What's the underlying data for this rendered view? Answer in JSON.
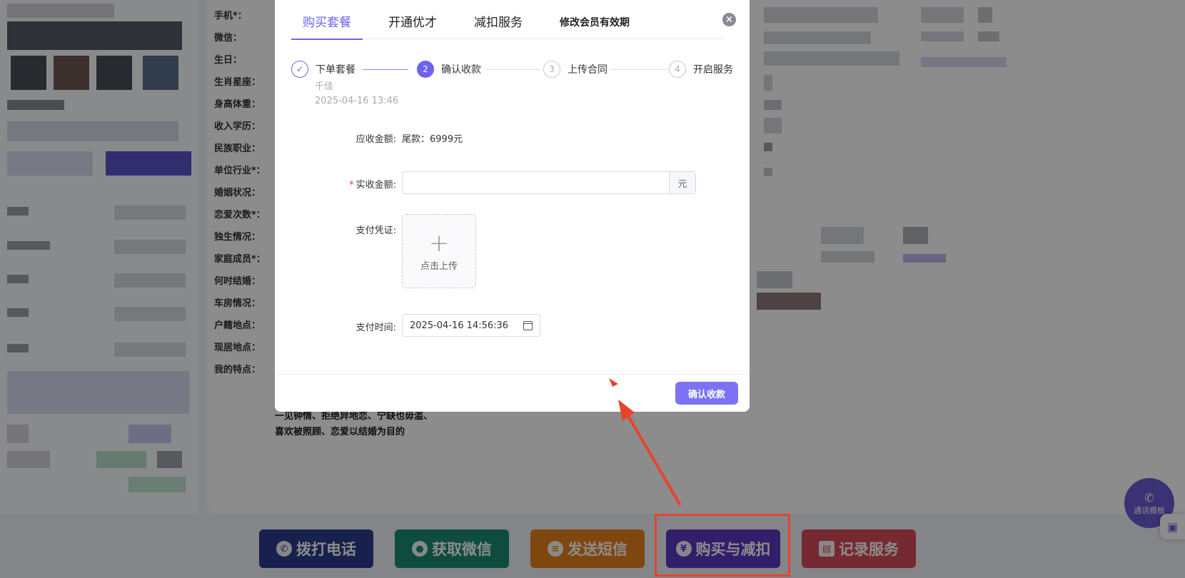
{
  "background": {
    "field_labels": [
      "手机*：",
      "微信：",
      "生日：",
      "生肖星座：",
      "身高体重：",
      "收入学历：",
      "民族职业：",
      "单位行业*：",
      "婚姻状况：",
      "恋爱次数*：",
      "独生情况：",
      "家庭成员*：",
      "何时结婚：",
      "车房情况：",
      "户籍地点：",
      "现居地点：",
      "我的特点："
    ],
    "features_text": [
      "一见钟情、拒绝异地恋、宁缺也毋滥、",
      "喜欢被照顾、恋爱以结婚为目的"
    ],
    "actions": {
      "call": "拨打电话",
      "wechat": "获取微信",
      "sms": "发送短信",
      "buy": "购买与减扣",
      "record": "记录服务"
    },
    "float_call_label": "通话模板",
    "colors": {
      "call": "#2d3d8c",
      "wechat": "#1a8b73",
      "sms": "#e8821e",
      "buy": "#5b37c4",
      "record": "#d74b5a",
      "highlight": "#e8432f"
    }
  },
  "modal": {
    "tabs": [
      "购买套餐",
      "开通优才",
      "减扣服务",
      "修改会员有效期"
    ],
    "active_tab": "购买套餐",
    "close_icon": "×",
    "steps": [
      {
        "num": "✓",
        "label": "下单套餐",
        "state": "done"
      },
      {
        "num": "2",
        "label": "确认收款",
        "state": "active"
      },
      {
        "num": "3",
        "label": "上传合同",
        "state": "pending"
      },
      {
        "num": "4",
        "label": "开启服务",
        "state": "pending"
      }
    ],
    "step_sub_name": "千佳",
    "step_sub_time": "2025-04-16 13:46",
    "receivable_label": "应收金额:",
    "receivable_value": "尾款：6999元",
    "actual_label": "实收金额:",
    "actual_required": "*",
    "actual_value": "",
    "actual_suffix": "元",
    "voucher_label": "支付凭证:",
    "upload_plus": "+",
    "upload_text": "点击上传",
    "time_label": "支付时间:",
    "time_value": "2025-04-16 14:56:36",
    "confirm_button": "确认收款",
    "accent": "#6b63f0"
  }
}
